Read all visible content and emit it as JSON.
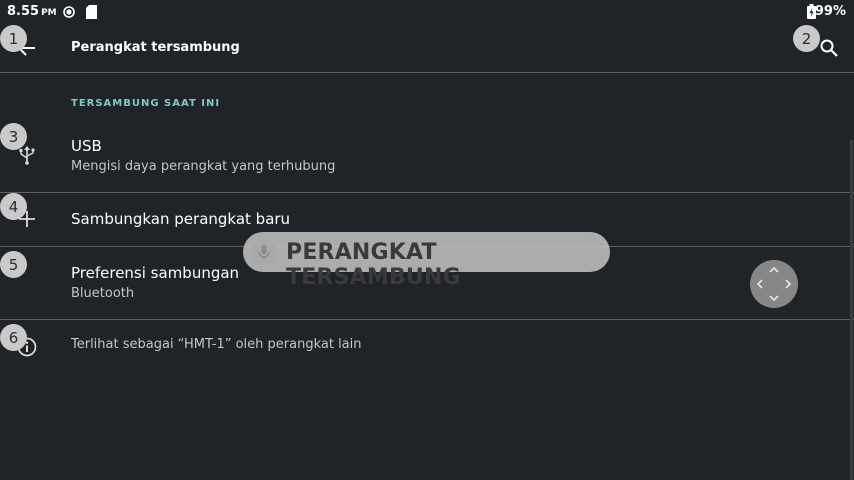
{
  "status_bar": {
    "time": "8.55",
    "ampm": "PM",
    "battery": "99%",
    "icons": [
      "location-target-icon",
      "sd-card-icon",
      "battery-charging-icon"
    ]
  },
  "toolbar": {
    "title": "Perangkat tersambung",
    "back_icon": "arrow-left-icon",
    "search_icon": "search-icon"
  },
  "section": {
    "header": "TERSAMBUNG SAAT INI"
  },
  "items": [
    {
      "title": "USB",
      "subtitle": "Mengisi daya perangkat yang terhubung",
      "icon": "usb-icon"
    },
    {
      "title": "Sambungkan perangkat baru",
      "icon": "plus-icon"
    },
    {
      "title": "Preferensi sambungan",
      "subtitle": "Bluetooth",
      "icon": "none"
    },
    {
      "title": "Terlihat sebagai “HMT-1” oleh perangkat lain",
      "icon": "info-icon"
    }
  ],
  "badges": [
    "1",
    "2",
    "3",
    "4",
    "5",
    "6"
  ],
  "voice_overlay": {
    "text": "PERANGKAT TERSAMBUNG",
    "icon": "microphone-icon"
  },
  "nav_control": {
    "icon": "dpad-arrows-icon"
  },
  "colors": {
    "background": "#202327",
    "accent": "#7fcbc4",
    "divider": "#5c6166",
    "badge": "#c9c9c9"
  }
}
